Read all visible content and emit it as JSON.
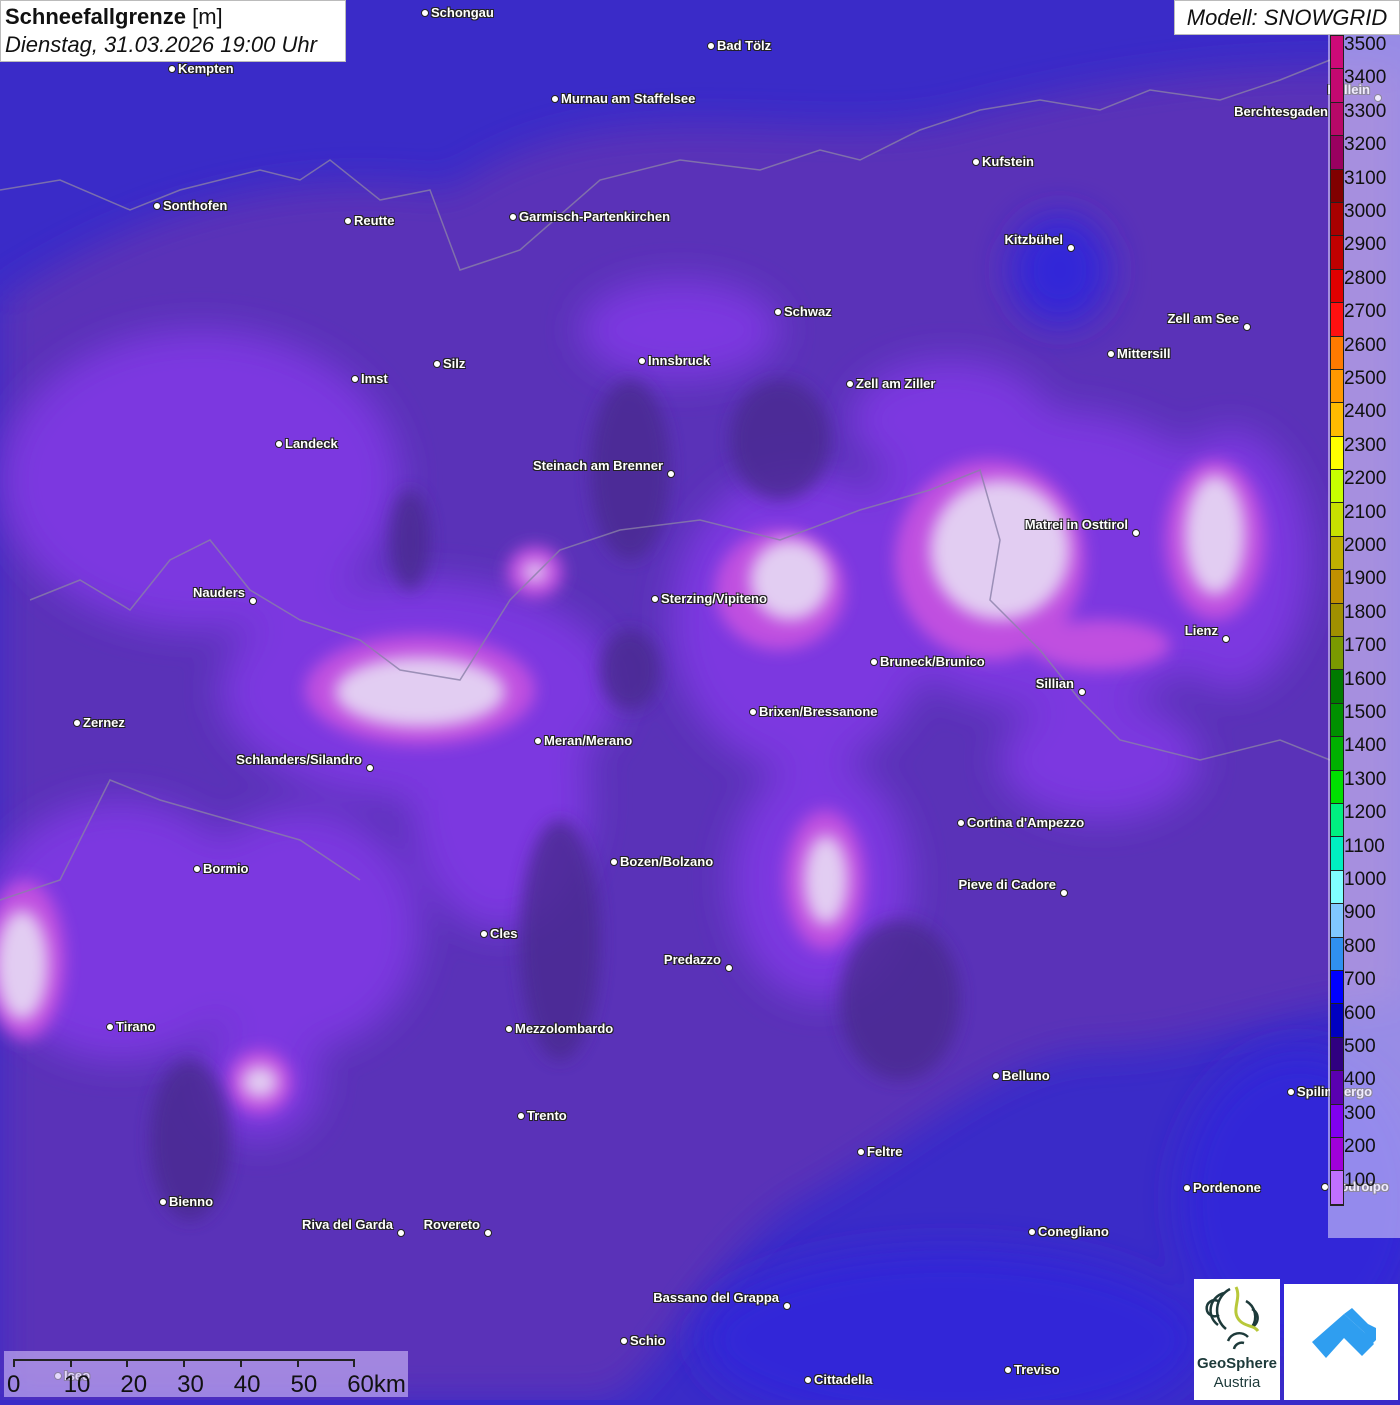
{
  "header": {
    "title": "Schneefallgrenze",
    "unit": "[m]",
    "datetime": "Dienstag, 31.03.2026 19:00 Uhr",
    "model": "Modell: SNOWGRID"
  },
  "legend": {
    "labels": [
      "3500",
      "3400",
      "3300",
      "3200",
      "3100",
      "3000",
      "2900",
      "2800",
      "2700",
      "2600",
      "2500",
      "2400",
      "2300",
      "2200",
      "2100",
      "2000",
      "1900",
      "1800",
      "1700",
      "1600",
      "1500",
      "1400",
      "1300",
      "1200",
      "1100",
      "1000",
      "900",
      "800",
      "700",
      "600",
      "500",
      "400",
      "300",
      "200",
      "100"
    ],
    "colors": [
      "#cc0a78",
      "#c40870",
      "#b80868",
      "#9a0060",
      "#800000",
      "#a80000",
      "#c00000",
      "#e00000",
      "#ff1010",
      "#ff7a00",
      "#ff9800",
      "#ffbb00",
      "#ffff00",
      "#c8ff00",
      "#c8e000",
      "#c0b000",
      "#c09000",
      "#a09000",
      "#7a9a00",
      "#007a00",
      "#009000",
      "#00b000",
      "#00e000",
      "#00f080",
      "#00f0c0",
      "#80ffff",
      "#80c8ff",
      "#3090f0",
      "#0000ff",
      "#0000c0",
      "#300080",
      "#5a00b0",
      "#8000f0",
      "#a000d8",
      "#c070ff"
    ]
  },
  "cities": [
    "Schongau",
    "Bad Tölz",
    "Kempten",
    "Murnau am Staffelsee",
    "Hallein",
    "Berchtesgaden",
    "Kufstein",
    "Sonthofen",
    "Reutte",
    "Garmisch-Partenkirchen",
    "Kitzbühel",
    "Schwaz",
    "Zell am See",
    "Mittersill",
    "Imst",
    "Silz",
    "Innsbruck",
    "Zell am Ziller",
    "Landeck",
    "Steinach am Brenner",
    "Matrei in Osttirol",
    "Nauders",
    "Sterzing/Vipiteno",
    "Lienz",
    "Bruneck/Brunico",
    "Sillian",
    "Zernez",
    "Brixen/Bressanone",
    "Meran/Merano",
    "Schlanders/Silandro",
    "Cortina d'Ampezzo",
    "Bormio",
    "Bozen/Bolzano",
    "Pieve di Cadore",
    "Cles",
    "Predazzo",
    "Tirano",
    "Mezzolombardo",
    "Belluno",
    "Spilimbergo",
    "Trento",
    "Feltre",
    "Pordenone",
    "Codroipo",
    "Bienno",
    "Riva del Garda",
    "Rovereto",
    "Conegliano",
    "Bassano del Grappa",
    "Schio",
    "Iseo",
    "Treviso",
    "Cittadella"
  ],
  "scale": {
    "ticks": [
      "0",
      "10",
      "20",
      "30",
      "40",
      "50",
      "60km"
    ]
  },
  "logos": {
    "geosphere_line1": "GeoSphere",
    "geosphere_line2": "Austria"
  },
  "colors": {
    "low_blue": "#3a2bc8",
    "base_purple": "#5a30b8",
    "mid_purple": "#8038e8",
    "light": "#e2cdf2"
  }
}
